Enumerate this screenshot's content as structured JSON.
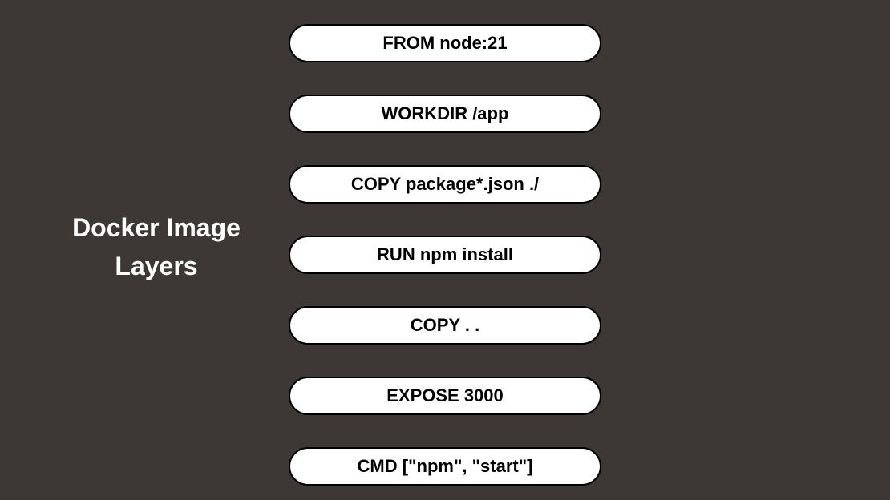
{
  "title": {
    "line1": "Docker Image",
    "line2": "Layers"
  },
  "layers": [
    "FROM node:21",
    "WORKDIR /app",
    "COPY package*.json ./",
    "RUN npm install",
    "COPY . .",
    "EXPOSE 3000",
    "CMD [\"npm\", \"start\"]"
  ]
}
